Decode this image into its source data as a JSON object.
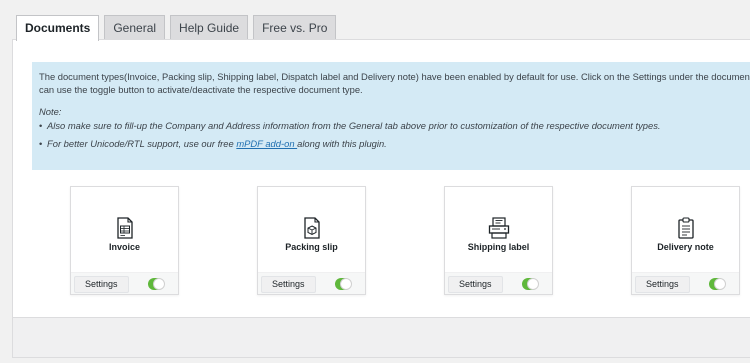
{
  "tabs": [
    {
      "label": "Documents",
      "active": true
    },
    {
      "label": "General",
      "active": false
    },
    {
      "label": "Help Guide",
      "active": false
    },
    {
      "label": "Free vs. Pro",
      "active": false
    }
  ],
  "notice": {
    "intro_line1": "The document types(Invoice, Packing slip, Shipping label, Dispatch label and Delivery note) have been enabled by default for use. Click on the Settings under the document type",
    "intro_line2": "can use the toggle button to activate/deactivate the respective document type.",
    "note_title": "Note:",
    "bullet1": "Also make sure to fill-up the Company and Address information from the General tab above prior to customization of the respective document types.",
    "bullet2_before": "For better Unicode/RTL support, use our free ",
    "bullet2_link": "mPDF add-on ",
    "bullet2_after": "along with this plugin."
  },
  "cards": [
    {
      "title": "Invoice",
      "icon": "invoice-icon",
      "settings_label": "Settings",
      "enabled": true
    },
    {
      "title": "Packing slip",
      "icon": "packing-slip-icon",
      "settings_label": "Settings",
      "enabled": true
    },
    {
      "title": "Shipping label",
      "icon": "shipping-label-icon",
      "settings_label": "Settings",
      "enabled": true
    },
    {
      "title": "Delivery note",
      "icon": "delivery-note-icon",
      "settings_label": "Settings",
      "enabled": true
    }
  ],
  "colors": {
    "toggle_on": "#5fb83b",
    "notice_bg": "#d4eaf5",
    "link": "#2271b1"
  }
}
